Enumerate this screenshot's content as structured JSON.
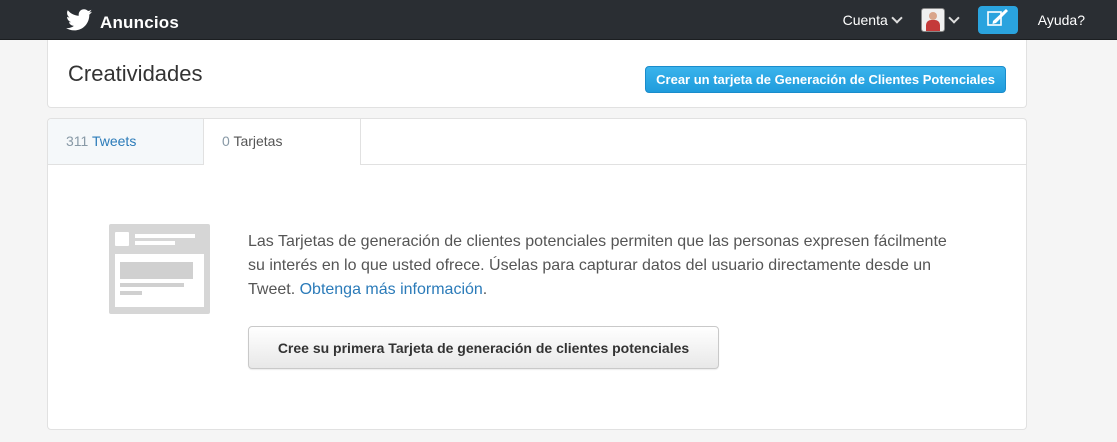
{
  "nav": {
    "brand": "Anuncios",
    "account_label": "Cuenta",
    "help_label": "Ayuda?",
    "brand_icon": "twitter-bird-icon",
    "compose_icon": "compose-tweet-icon",
    "accent": "#2aa3de",
    "bar_color": "#2a2e33"
  },
  "header": {
    "title": "Creatividades",
    "create_button": "Crear un tarjeta de Generación de Clientes Potenciales"
  },
  "tabs": [
    {
      "count": "311",
      "label": "Tweets"
    },
    {
      "count": "0",
      "label": "Tarjetas"
    }
  ],
  "empty_state": {
    "text": "Las Tarjetas de generación de clientes potenciales permiten que las personas expresen fácilmente su interés en lo que usted ofrece. Úselas para capturar datos del usuario directamente desde un Tweet.",
    "link": "Obtenga más información",
    "link_suffix": ".",
    "button": "Cree su primera Tarjeta de generación de clientes potenciales",
    "illustration_icon": "lead-card-illustration-icon"
  }
}
